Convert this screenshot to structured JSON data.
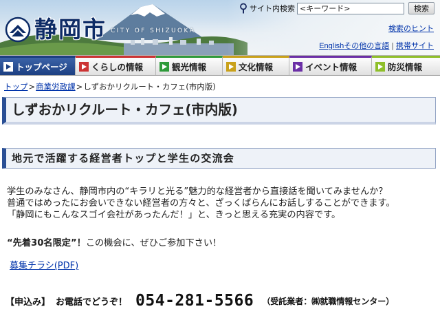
{
  "header": {
    "logo_text": "静岡市",
    "logo_subtext": "CITY OF SHIZUOKA",
    "search_label": "サイト内検索",
    "search_value": "<キーワード>",
    "search_button": "検索",
    "hint_link": "検索のヒント",
    "lang_links": {
      "english": "English",
      "other": "その他の言語",
      "separator": "|",
      "mobile": "携帯サイト"
    }
  },
  "nav": {
    "items": [
      {
        "label": "トップページ",
        "color": "#1c3f82"
      },
      {
        "label": "くらしの情報",
        "color": "#cc3333"
      },
      {
        "label": "観光情報",
        "color": "#2e9a3a"
      },
      {
        "label": "文化情報",
        "color": "#c9a11a"
      },
      {
        "label": "イベント情報",
        "color": "#6b2fa6"
      },
      {
        "label": "防災情報",
        "color": "#8fbf2a"
      }
    ]
  },
  "breadcrumb": {
    "home": "トップ",
    "section": "商業労政課",
    "separator": ">",
    "current": "しずおかリクルート・カフェ(市内版)"
  },
  "content": {
    "title": "しずおかリクルート・カフェ(市内版)",
    "subtitle": "地元で活躍する経営者トップと学生の交流会",
    "intro": [
      "学生のみなさん、静岡市内の“キラリと光る”魅力的な経営者から直接話を聞いてみませんか？",
      "普通ではめったにお会いできない経営者の方々と、ざっくばらんにお話しすることができます。",
      "「静岡にもこんなスゴイ会社があったんだ！」と、きっと思える充実の内容です。"
    ],
    "limited_bold": "“先着30名限定”！",
    "limited_rest": "この機会に、ぜひご参加下さい！",
    "flyer_link": "募集チラシ(PDF)",
    "apply_label": "【申込み】",
    "apply_call": "お電話でどうぞ！",
    "apply_phone": "054-281-5566",
    "apply_vendor": "（受託業者：㈱就職情報センター）"
  },
  "colors": {
    "brand_navy": "#1c3f82",
    "link": "#0033aa",
    "heading_bg": "#eef2f8"
  },
  "icons": {
    "search": "magnifier-icon",
    "nav_arrow": "arrow-right-icon",
    "logo": "shizuoka-city-emblem"
  }
}
